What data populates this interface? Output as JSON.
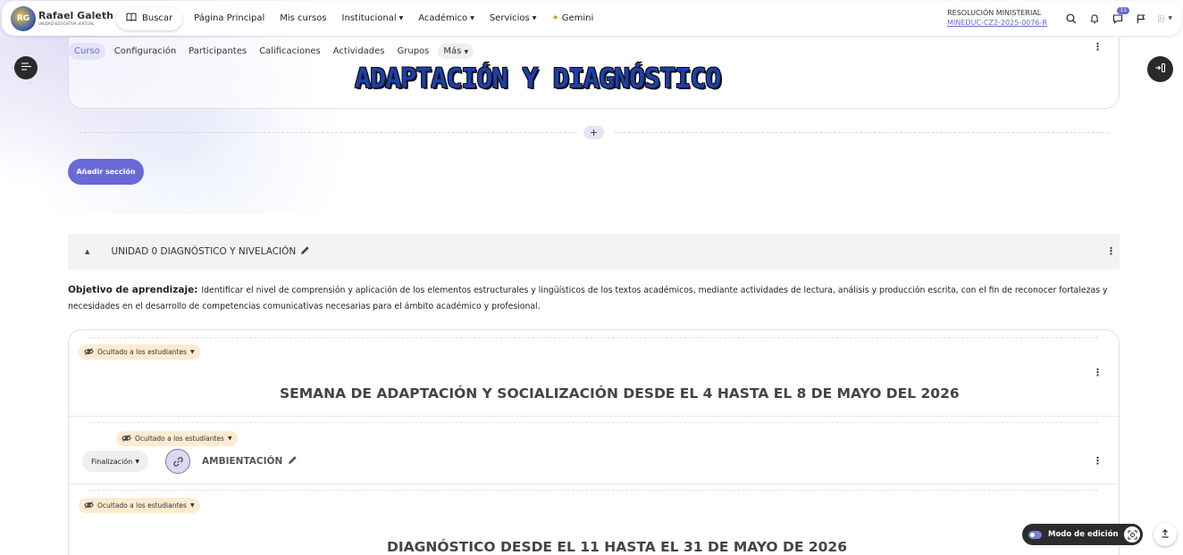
{
  "brand": {
    "name": "Rafael Galeth",
    "subtitle": "UNIDAD EDUCATIVA VIRTUAL",
    "badge": "RG"
  },
  "navbar": {
    "search_label": "Buscar",
    "items": [
      {
        "label": "Página Principal",
        "dropdown": false
      },
      {
        "label": "Mis cursos",
        "dropdown": false
      },
      {
        "label": "Institucional",
        "dropdown": true
      },
      {
        "label": "Académico",
        "dropdown": true
      },
      {
        "label": "Servicios",
        "dropdown": true
      },
      {
        "label": "Gemini",
        "dropdown": false
      }
    ],
    "resolution_title": "RESOLUCIÓN MINISTERIAL",
    "resolution_link": "MINEDUC-CZ2-2025-0076-R",
    "notification_count": "11",
    "icons": [
      "search-icon",
      "bell-icon",
      "chat-icon",
      "flag-icon",
      "avatar"
    ]
  },
  "course_nav": {
    "items": [
      "Curso",
      "Configuración",
      "Participantes",
      "Calificaciones",
      "Actividades",
      "Grupos"
    ],
    "more_label": "Más",
    "active": "Curso"
  },
  "course": {
    "title": "ADAPTACIÓN Y DIAGNÓSTICO",
    "add_section_label": "Añadir sección"
  },
  "unit": {
    "title": "UNIDAD 0 DIAGNÓSTICO Y NIVELACIÓN",
    "objective_label": "Objetivo de aprendizaje:",
    "objective_text": "Identificar el nivel de comprensión y aplicación de los elementos estructurales y lingüísticos de los textos académicos, mediante actividades de lectura, análisis y producción escrita, con el fin de reconocer fortalezas y necesidades en el desarrollo de competencias comunicativas necesarias para el ámbito académico y profesional."
  },
  "content": {
    "hidden_label": "Ocultado a los estudiantes",
    "week1_title": "SEMANA DE ADAPTACIÓN Y SOCIALIZACIÓN DESDE EL 4 HASTA EL 8 DE MAYO DEL 2026",
    "completion_label": "Finalización",
    "activity_name": "AMBIENTACIÓN",
    "week2_title": "DIAGNÓSTICO DESDE EL 11 HASTA EL 31 DE MAYO DE 2026"
  },
  "footer": {
    "edit_mode_label": "Modo de edición"
  },
  "colors": {
    "accent": "#6a6ad6",
    "hidden_badge": "#fcebd0",
    "title_blue": "#1c3faa"
  }
}
